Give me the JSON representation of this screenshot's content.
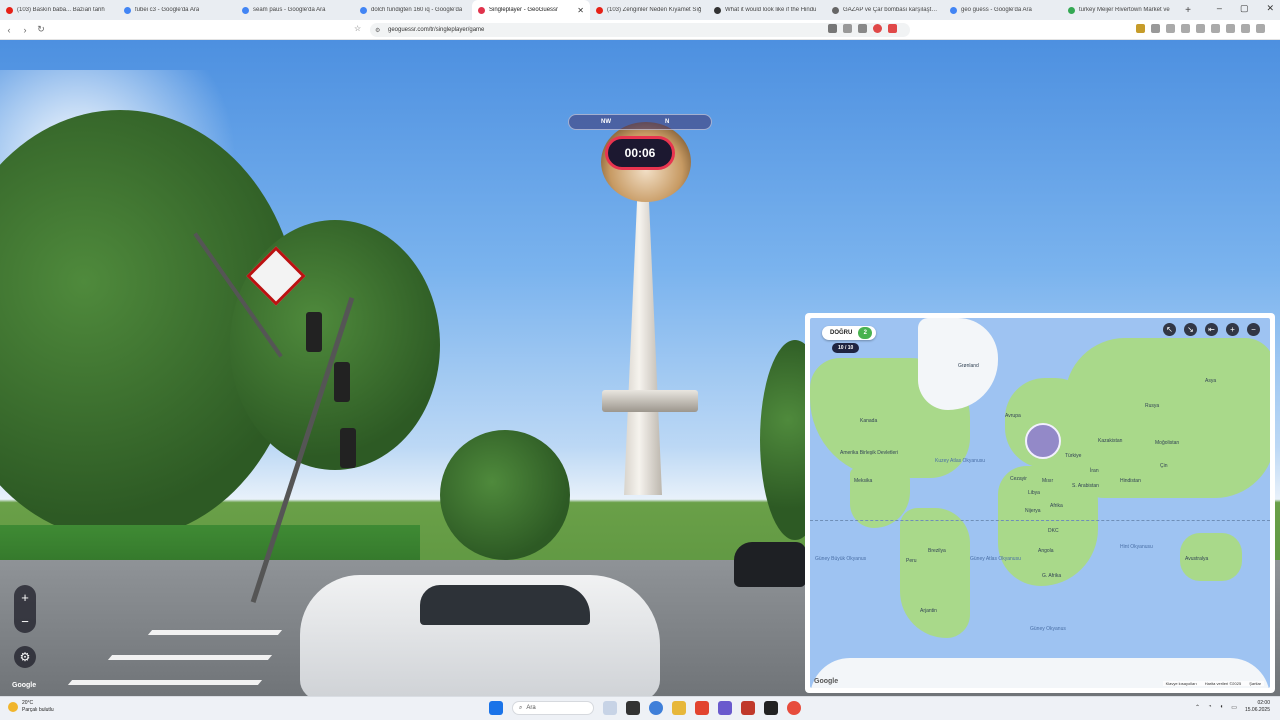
{
  "browser": {
    "tabs": [
      {
        "title": "(103) Baskın baba... Bazıan tarih",
        "icon": "youtube-icon",
        "color": "#e62117",
        "active": false
      },
      {
        "title": "fubei c3 - Google'da Ara",
        "icon": "google-icon",
        "color": "#4285f4",
        "active": false
      },
      {
        "title": "seam paus - Google'da Ara",
        "icon": "google-icon",
        "color": "#4285f4",
        "active": false
      },
      {
        "title": "dolch fundigten 160 iq - Google'da",
        "icon": "google-icon",
        "color": "#4285f4",
        "active": false
      },
      {
        "title": "Singleplayer - GeoGuessr",
        "icon": "geoguessr-icon",
        "color": "#e0334c",
        "active": true
      },
      {
        "title": "(103) Zenginler Neden Kıyamet Sığ",
        "icon": "youtube-icon",
        "color": "#e62117",
        "active": false
      },
      {
        "title": "What it would look like if the Hindu",
        "icon": "reddit-icon",
        "color": "#333333",
        "active": false
      },
      {
        "title": "GAZAP ve Çar bombası karşılaştırm",
        "icon": "site-icon",
        "color": "#666666",
        "active": false
      },
      {
        "title": "geo guess - Google'da Ara",
        "icon": "google-icon",
        "color": "#4285f4",
        "active": false
      },
      {
        "title": "turkey Meijer Rivertown Market ve",
        "icon": "maps-icon",
        "color": "#34a853",
        "active": false
      }
    ],
    "new_tab": "+",
    "window_controls": [
      "–",
      "▢",
      "✕"
    ],
    "url": "geoguessr.com/tr/singleplayer/game",
    "nav": {
      "back": "‹",
      "forward": "›",
      "reload": "↻"
    }
  },
  "game": {
    "timer": "00:06",
    "compass": {
      "left": "NW",
      "right": "N"
    },
    "controls": {
      "zoom_in": "+",
      "zoom_out": "−",
      "settings": "⚙"
    },
    "streetview_attribution": "Google"
  },
  "map": {
    "mode_label": "DOĞRU",
    "mode_count": "2",
    "progress": "10 / 10",
    "tools": [
      "↖",
      "↘",
      "⇤",
      "+",
      "−"
    ],
    "labels": {
      "greenland": "Grønland",
      "europe": "Avrupa",
      "asia": "Asya",
      "russia": "Rusya",
      "kazakhstan": "Kazakistan",
      "mongolia": "Moğolistan",
      "china": "Çin",
      "canada": "Kanada",
      "usa": "Amerika Birleşik Devletleri",
      "mexico": "Meksika",
      "north_atlantic": "Kuzey Atlas Okyanusu",
      "south_atlantic": "Güney Atlas Okyanusu",
      "south_pacific": "Güney Büyük Okyanus",
      "indian_ocean": "Hint Okyanusu",
      "southern_ocean": "Güney Okyanus",
      "africa": "Afrika",
      "brazil": "Brezilya",
      "peru": "Peru",
      "argentina": "Arjantin",
      "australia": "Avustralya",
      "india": "Hindistan",
      "saudi": "S. Arabistan",
      "egypt": "Mısır",
      "algeria": "Cezayir",
      "libya": "Libya",
      "nigeria": "Nijerya",
      "congo": "DKC",
      "angola": "Angola",
      "south_africa": "G. Afrika",
      "iran": "İran",
      "turkey": "Türkiye"
    },
    "footer": {
      "shortcuts": "Klavye kısayolları",
      "data": "Harita verileri ©2025",
      "terms": "Şartlar"
    },
    "attribution": "Google"
  },
  "taskbar": {
    "weather_temp": "20°C",
    "weather_desc": "Parçalı bulutlu",
    "search_placeholder": "Ara",
    "time": "02:00",
    "date": "15.06.2025"
  },
  "colors": {
    "accent": "#e8344f",
    "mode_badge": "#49b24f",
    "guess_marker": "#8c6edc"
  }
}
